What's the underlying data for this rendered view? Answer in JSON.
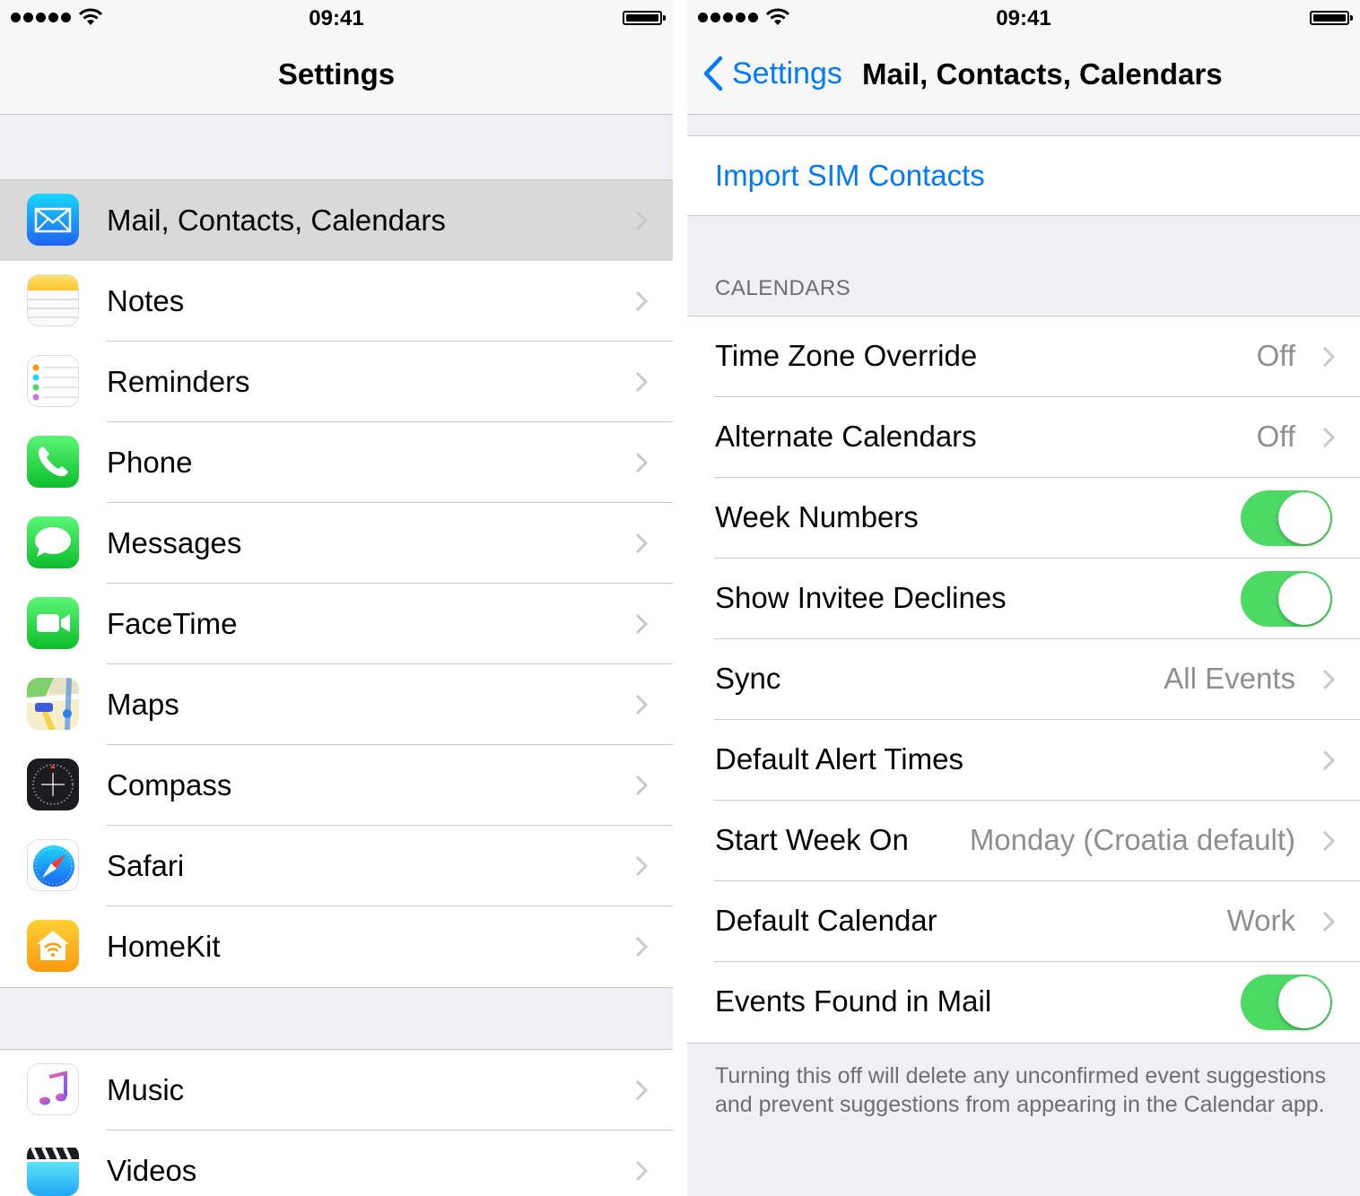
{
  "left_panel": {
    "status": {
      "time": "09:41"
    },
    "nav": {
      "title": "Settings"
    },
    "group1": [
      {
        "label": "Mail, Contacts, Calendars",
        "icon": "mail-icon",
        "selected": true
      },
      {
        "label": "Notes",
        "icon": "notes-icon"
      },
      {
        "label": "Reminders",
        "icon": "reminders-icon"
      },
      {
        "label": "Phone",
        "icon": "phone-icon"
      },
      {
        "label": "Messages",
        "icon": "messages-icon"
      },
      {
        "label": "FaceTime",
        "icon": "facetime-icon"
      },
      {
        "label": "Maps",
        "icon": "maps-icon"
      },
      {
        "label": "Compass",
        "icon": "compass-icon"
      },
      {
        "label": "Safari",
        "icon": "safari-icon"
      },
      {
        "label": "HomeKit",
        "icon": "homekit-icon"
      }
    ],
    "group2": [
      {
        "label": "Music",
        "icon": "music-icon"
      },
      {
        "label": "Videos",
        "icon": "videos-icon"
      }
    ]
  },
  "right_panel": {
    "status": {
      "time": "09:41"
    },
    "nav": {
      "back_label": "Settings",
      "title": "Mail, Contacts, Calendars"
    },
    "import_link": "Import SIM Contacts",
    "section_header": "CALENDARS",
    "rows": [
      {
        "label": "Time Zone Override",
        "value": "Off"
      },
      {
        "label": "Alternate Calendars",
        "value": "Off"
      },
      {
        "label": "Week Numbers",
        "toggle": true
      },
      {
        "label": "Show Invitee Declines",
        "toggle": true
      },
      {
        "label": "Sync",
        "value": "All Events"
      },
      {
        "label": "Default Alert Times",
        "value": ""
      },
      {
        "label": "Start Week On",
        "value": "Monday (Croatia default)"
      },
      {
        "label": "Default Calendar",
        "value": "Work"
      },
      {
        "label": "Events Found in Mail",
        "toggle": true
      }
    ],
    "footer": "Turning this off will delete any unconfirmed event suggestions and prevent suggestions from appearing in the Calendar app."
  },
  "colors": {
    "tint": "#007aff",
    "toggle_on": "#4cd964",
    "background": "#efeff4",
    "separator": "#c8c7cc",
    "secondary_text": "#8e8e93"
  }
}
